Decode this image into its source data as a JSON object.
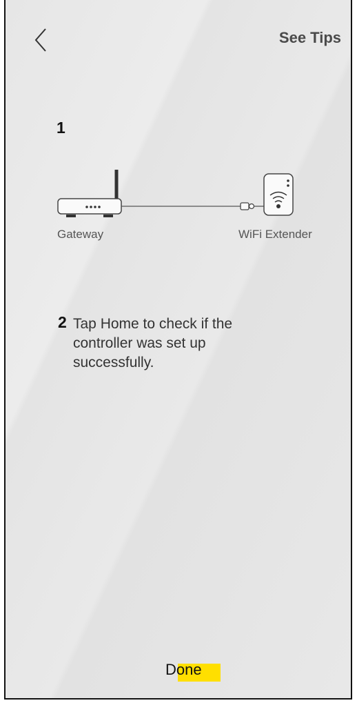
{
  "header": {
    "back_icon": "chevron-left-icon",
    "see_tips_label": "See Tips"
  },
  "step1": {
    "number": "1",
    "gateway_label": "Gateway",
    "extender_label": "WiFi Extender",
    "icons": [
      "router-icon",
      "ethernet-cable-icon",
      "wifi-extender-icon"
    ]
  },
  "step2": {
    "number": "2",
    "text": "Tap Home to check if the controller was set up successfully."
  },
  "footer": {
    "done_label": "Done",
    "highlight_color": "#ffdf00"
  }
}
